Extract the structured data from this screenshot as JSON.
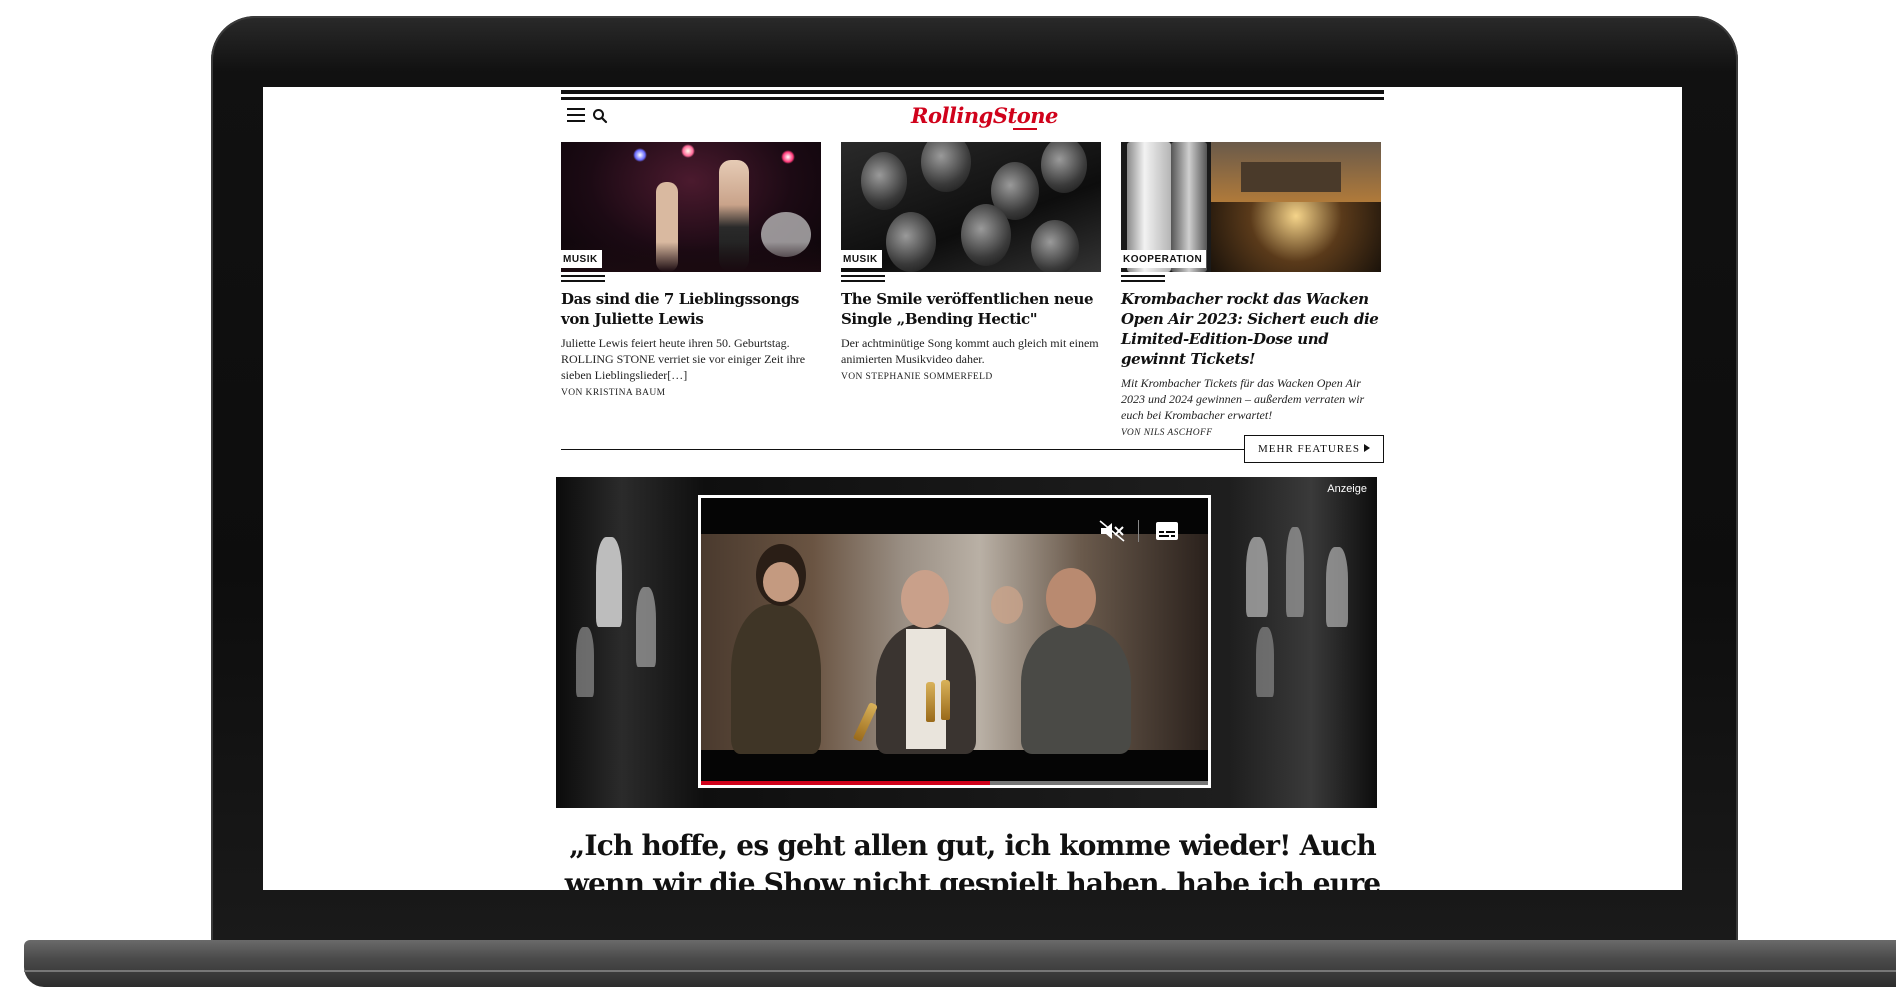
{
  "header": {
    "logo_text": "RollingStone",
    "menu_icon": "hamburger-menu-icon",
    "search_icon": "search-icon",
    "brand_color": "#d0021b"
  },
  "articles": [
    {
      "tag": "MUSIK",
      "title": "Das sind die 7 Lieblingssongs von Juliette Lewis",
      "description": "Juliette Lewis feiert heute ihren 50. Geburtstag. ROLLING STONE verriet sie vor einiger Zeit ihre sieben Lieblingslieder[…]",
      "byline": "VON KRISTINA BAUM"
    },
    {
      "tag": "MUSIK",
      "title": "The Smile veröffentlichen neue Single „Bending Hectic\"",
      "description": "Der achtminütige Song kommt auch gleich mit einem animierten Musikvideo daher.",
      "byline": "VON STEPHANIE SOMMERFELD"
    },
    {
      "tag": "KOOPERATION",
      "title": "Krombacher rockt das Wacken Open Air 2023: Sichert euch die Limited-Edition-Dose und gewinnt Tickets!",
      "description": "Mit Krombacher Tickets für das Wacken Open Air 2023 und 2024 gewinnen – außerdem verraten wir euch bei Krombacher erwartet!",
      "byline": "VON NILS ASCHOFF"
    }
  ],
  "more_features": {
    "label": "MEHR FEATURES"
  },
  "ad": {
    "label": "Anzeige",
    "video": {
      "mute_icon": "muted-speaker-icon",
      "captions_icon": "subtitles-icon",
      "progress": 0.57
    }
  },
  "headline": {
    "line1": "„Ich hoffe, es geht allen gut, ich komme wieder! Auch",
    "line2": "wenn wir die Show nicht gespielt haben, habe ich eure"
  }
}
